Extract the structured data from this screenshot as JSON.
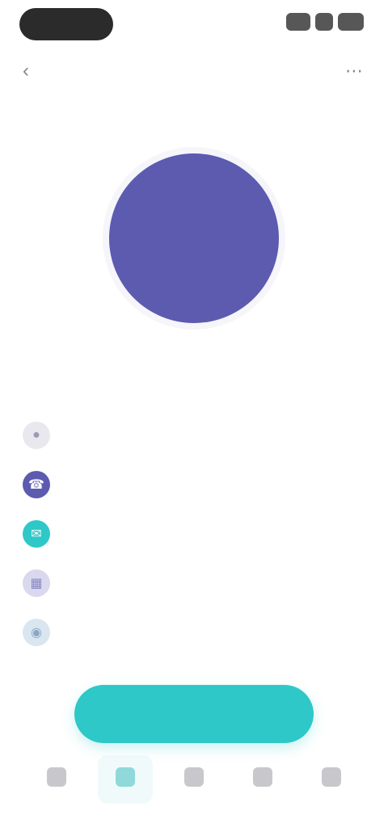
{
  "status_bar": {},
  "header": {
    "title": "",
    "back_icon": "chevron-left-icon",
    "more_icon": "more-icon"
  },
  "profile": {
    "initials": "",
    "display_name": "",
    "avatar_color": "#5c5bb0"
  },
  "details": [
    {
      "icon": "user-icon",
      "color": "#e8e8ee",
      "label": "",
      "value": ""
    },
    {
      "icon": "phone-icon",
      "color": "#5c5bb0",
      "label": "",
      "value": ""
    },
    {
      "icon": "mail-icon",
      "color": "#2ec8c8",
      "label": "",
      "value": ""
    },
    {
      "icon": "calendar-icon",
      "color": "#d9d8ee",
      "label": "",
      "value": ""
    },
    {
      "icon": "location-icon",
      "color": "#d9e6f0",
      "label": "",
      "value": ""
    }
  ],
  "primary_button": {
    "label": "",
    "color": "#2ec8c8"
  },
  "bottom_nav": [
    {
      "icon": "home-icon",
      "label": ""
    },
    {
      "icon": "contacts-icon",
      "label": "",
      "active": true
    },
    {
      "icon": "chat-icon",
      "label": ""
    },
    {
      "icon": "calendar-icon",
      "label": ""
    },
    {
      "icon": "settings-icon",
      "label": ""
    }
  ]
}
